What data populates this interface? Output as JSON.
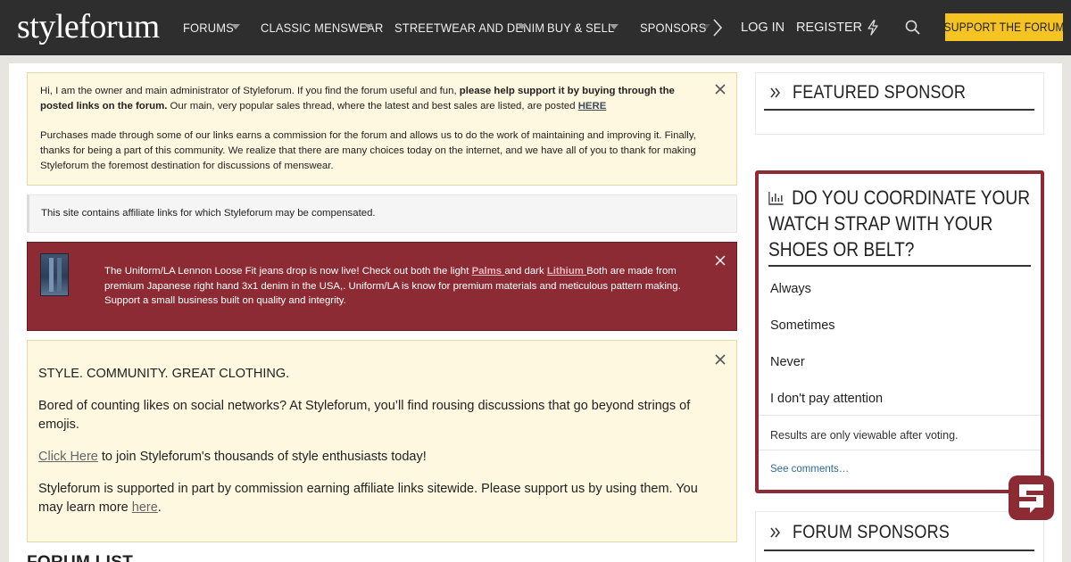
{
  "header": {
    "logo": "styleforum",
    "nav": [
      {
        "label": "FORUMS"
      },
      {
        "label": "CLASSIC MENSWEAR"
      },
      {
        "label": "STREETWEAR AND DENIM"
      },
      {
        "label": "BUY & SELL"
      },
      {
        "label": "SPONSORS"
      }
    ],
    "login": "LOG IN",
    "register": "REGISTER",
    "support_label": "SUPPORT THE FORUM",
    "icons": [
      "bolt-icon",
      "search-icon",
      "chevron-right-icon",
      "chevron-down-icon"
    ]
  },
  "notice1": {
    "p1_start": "Hi, I am the owner and main administrator of Styleforum. If you find the forum useful and fun, ",
    "p1_bold": "please help support it by buying through the posted links on the forum.",
    "p1_end": " Our main, very popular sales thread, where the latest and best sales are listed, are posted ",
    "p1_link": "HERE",
    "p2": "Purchases made through some of our links earns a commission for the forum and allows us to do the work of maintaining and improving it. Finally, thanks for being a part of this community. We realize that there are many choices today on the internet, and we have all of you to thank for making Styleforum the foremost destination for discussions of menswear."
  },
  "affiliate_notice": "This site contains affiliate links for which Styleforum may be compensated.",
  "promo": {
    "t1": "The Uniform/LA Lennon Loose Fit jeans drop is now live! Check out both the light ",
    "link1": "Palms ",
    "t2": "and dark ",
    "link2": "Lithium ",
    "t3": "Both are made from premium Japanese right hand 3x1 denim in the USA,. Uniform/LA is know for premium materials and meticulous pattern making. Support a small business built on quality and integrity."
  },
  "notice2": {
    "heading": "STYLE. COMMUNITY. GREAT CLOTHING.",
    "p1": "Bored of counting likes on social networks? At Styleforum, you’ll find rousing discussions that go beyond strings of emojis.",
    "p2_link": "Click Here",
    "p2_rest": " to join Styleforum's thousands of style enthusiasts today!",
    "p3_start": "Styleforum is supported in part by commission earning affiliate links sitewide. Please support us by using them. You may learn more ",
    "p3_link": "here",
    "p3_end": "."
  },
  "forum_list_heading": "FORUM LIST",
  "sidebar": {
    "featured_sponsor": "FEATURED SPONSOR",
    "forum_sponsors": "FORUM SPONSORS",
    "poll": {
      "title": "DO YOU COORDINATE YOUR WATCH STRAP WITH YOUR SHOES OR BELT?",
      "options": [
        "Always",
        "Sometimes",
        "Never",
        "I don't pay attention"
      ],
      "note": "Results are only viewable after voting.",
      "comments_link": "See comments…"
    }
  },
  "colors": {
    "header_bg": "#2e2e2e",
    "support_button": "#f6c422",
    "accent_red": "#8c2b34",
    "notice_bg": "#fdf8df"
  }
}
